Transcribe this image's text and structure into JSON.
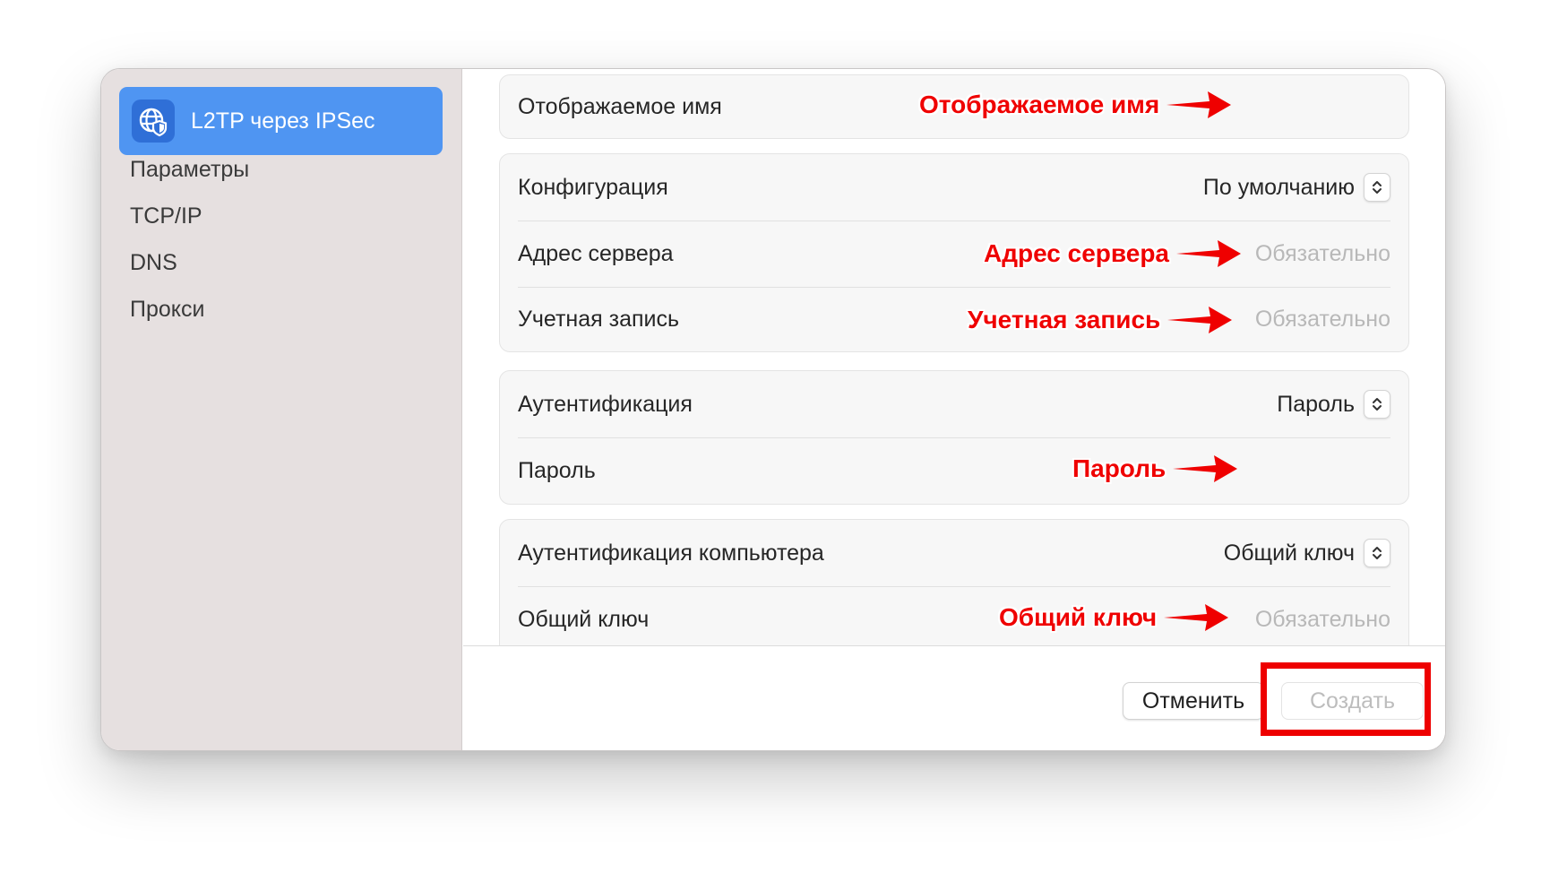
{
  "sidebar": {
    "selected": {
      "label": "L2TP через IPSec",
      "icon": "globe-shield-icon"
    },
    "items": [
      "Параметры",
      "TCP/IP",
      "DNS",
      "Прокси"
    ]
  },
  "fields": {
    "display_name": {
      "label": "Отображаемое имя",
      "value": ""
    },
    "configuration": {
      "label": "Конфигурация",
      "value": "По умолчанию"
    },
    "server_address": {
      "label": "Адрес сервера",
      "placeholder": "Обязательно"
    },
    "account": {
      "label": "Учетная запись",
      "placeholder": "Обязательно"
    },
    "authentication": {
      "label": "Аутентификация",
      "value": "Пароль"
    },
    "password": {
      "label": "Пароль",
      "value": ""
    },
    "machine_auth": {
      "label": "Аутентификация компьютера",
      "value": "Общий ключ"
    },
    "shared_secret": {
      "label": "Общий ключ",
      "placeholder": "Обязательно"
    }
  },
  "annotations": {
    "display_name": "Отображаемое имя",
    "server_address": "Адрес сервера",
    "account": "Учетная запись",
    "password": "Пароль",
    "shared_secret": "Общий ключ",
    "color": "#ef0000"
  },
  "footer": {
    "cancel_label": "Отменить",
    "create_label": "Создать"
  },
  "colors": {
    "accent": "#4f95f2",
    "sidebar_bg": "#e6e0e0",
    "annotation": "#ef0000"
  }
}
